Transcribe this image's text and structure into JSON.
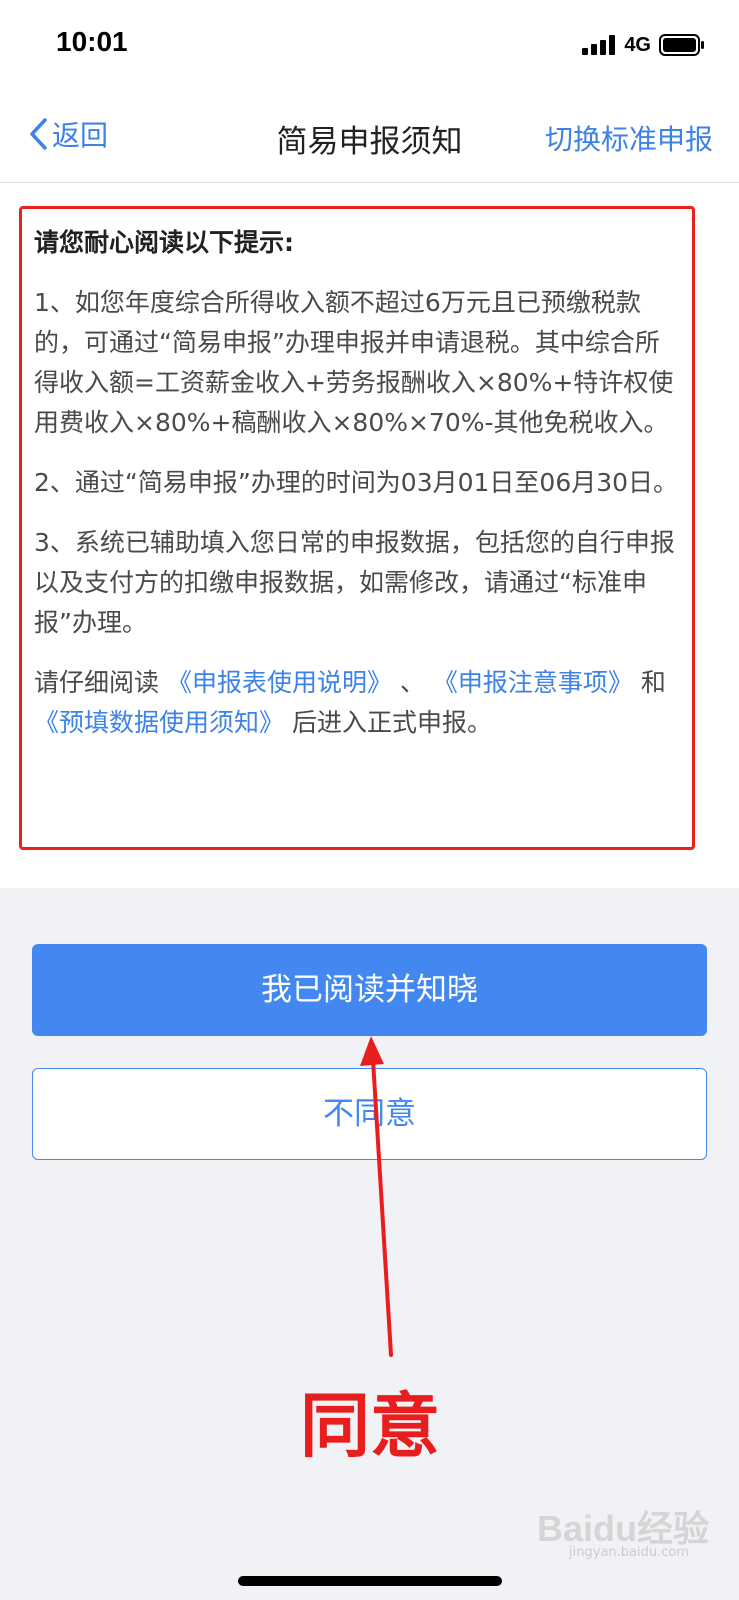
{
  "status_bar": {
    "time": "10:01",
    "network": "4G"
  },
  "nav": {
    "back_label": "返回",
    "title": "简易申报须知",
    "right_action": "切换标准申报"
  },
  "notice": {
    "heading": "请您耐心阅读以下提示:",
    "item1": "1、如您年度综合所得收入额不超过6万元且已预缴税款的，可通过“简易申报”办理申报并申请退税。其中综合所得收入额=工资薪金收入+劳务报酬收入×80%+特许权使用费收入×80%+稿酬收入×80%×70%-其他免税收入。",
    "item2": "2、通过“简易申报”办理的时间为03月01日至06月30日。",
    "item3": "3、系统已辅助填入您日常的申报数据，包括您的自行申报以及支付方的扣缴申报数据，如需修改，请通过“标准申报”办理。",
    "read_prefix": "请仔细阅读",
    "link1": "《申报表使用说明》",
    "sep": "、",
    "link2": "《申报注意事项》",
    "conj": "和",
    "link3": "《预填数据使用须知》",
    "read_suffix": "后进入正式申报。"
  },
  "buttons": {
    "agree": "我已阅读并知晓",
    "disagree": "不同意"
  },
  "annotation": {
    "text": "同意",
    "color": "#e81d1d"
  },
  "watermark": {
    "text": "Baidu经验",
    "sub": "jingyan.baidu.com"
  },
  "colors": {
    "accent": "#4288f0",
    "highlight_border": "#e8231f"
  }
}
